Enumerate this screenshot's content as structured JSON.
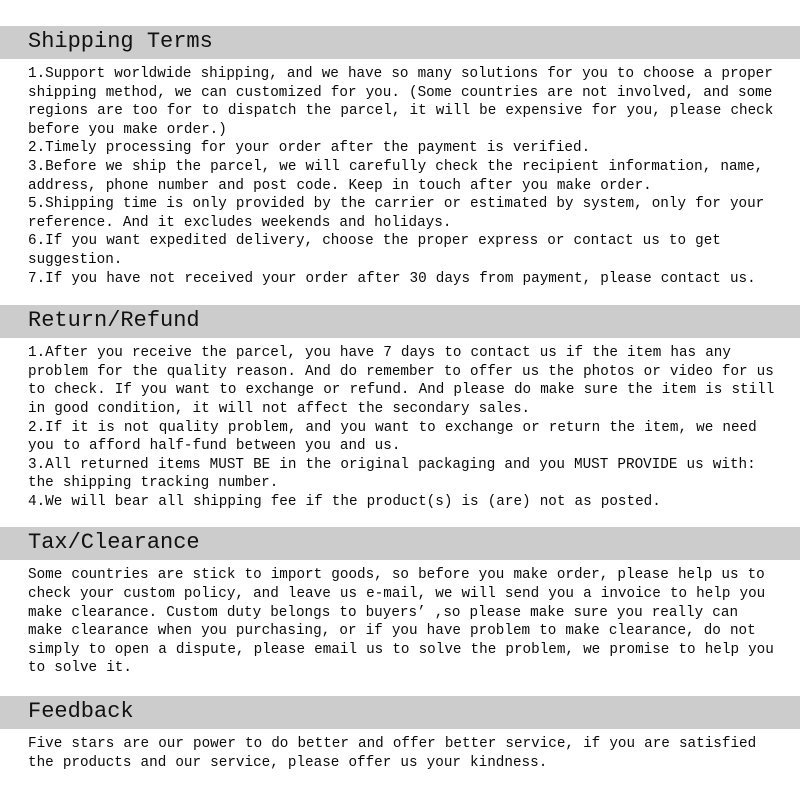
{
  "document": {
    "title": "Shipping, Return, Tax and Feedback Policy",
    "accent_band_color": "#cccccc",
    "text_color": "#000000",
    "background_color": "#ffffff"
  },
  "sections": [
    {
      "id": "shipping-terms",
      "heading": "Shipping Terms",
      "body": "1.Support worldwide shipping, and we have so many solutions for you to choose a proper shipping method, we can customized for you. (Some countries are not involved, and some regions are too for to dispatch the parcel, it will be expensive for you, please check before you make order.)\n2.Timely processing for your order after the payment is verified.\n3.Before we ship the parcel, we will carefully check the recipient information, name, address, phone number and post code. Keep in touch after you make order.\n5.Shipping time is only provided by the carrier or estimated by system, only for your reference. And it excludes weekends and holidays.\n6.If you want expedited delivery, choose the proper express or contact us to get suggestion.\n7.If you have not received your order after 30 days from payment, please contact us."
    },
    {
      "id": "return-refund",
      "heading": "Return/Refund",
      "body": "1.After you receive the parcel, you have 7 days to contact us if the item has any problem for the quality reason. And do remember to offer us the photos or video for us to check. If you want to exchange or refund. And please do make sure the item is still in good condition, it will not affect the secondary sales.\n2.If it is not quality problem, and you want to exchange or return the item, we need you to afford half-fund between you and us.\n3.All returned items MUST BE in the original packaging and you MUST PROVIDE us with: the shipping tracking number.\n4.We will bear all shipping fee if the product(s) is (are) not as posted."
    },
    {
      "id": "tax-clearance",
      "heading": "Tax/Clearance",
      "body": "Some countries are stick to import goods, so before you make order, please help us to check your custom policy, and leave us e-mail, we will send you a invoice to help you make clearance. Custom duty belongs to buyers’ ,so please make sure you really can make clearance when you purchasing, or if you have problem to make clearance, do not simply to open a dispute, please email us to solve the problem, we promise to help you to solve it."
    },
    {
      "id": "feedback",
      "heading": "Feedback",
      "body": "Five stars are our power to do better and offer better service, if you are satisfied the products and our service, please offer us your kindness."
    }
  ]
}
